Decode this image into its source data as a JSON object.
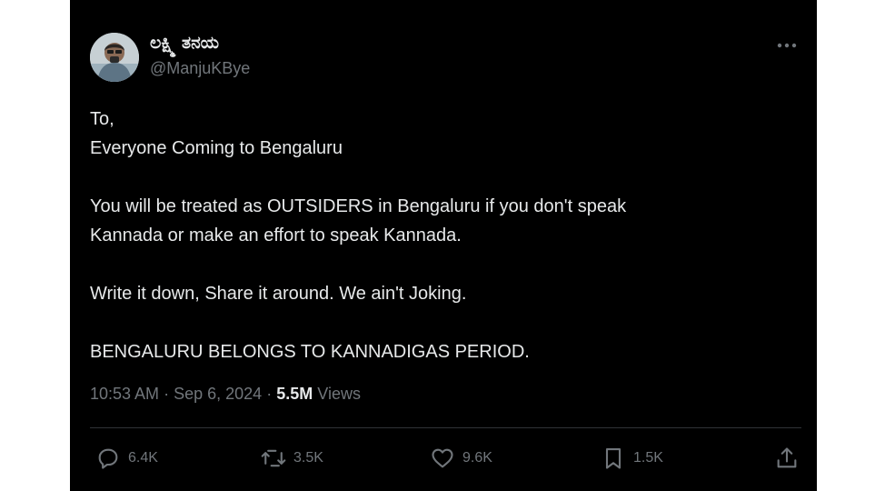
{
  "author": {
    "display_name": "ಲಕ್ಷ್ಮಿ ತನಯ",
    "handle": "@ManjuKBye",
    "avatar_icon": "user-photo-avatar"
  },
  "tweet": {
    "lines": [
      "To,",
      "Everyone Coming to Bengaluru",
      "",
      "You will be treated as OUTSIDERS in Bengaluru if you don't speak",
      "Kannada or make an effort to speak Kannada.",
      "",
      "Write it down, Share it around. We ain't Joking.",
      "",
      "BENGALURU BELONGS TO KANNADIGAS PERIOD."
    ],
    "time": "10:53 AM",
    "date": "Sep 6, 2024",
    "separator": "·",
    "views_count": "5.5M",
    "views_label": "Views"
  },
  "actions": {
    "replies": "6.4K",
    "reposts": "3.5K",
    "likes": "9.6K",
    "bookmarks": "1.5K"
  },
  "colors": {
    "background": "#000000",
    "text": "#e7e9ea",
    "muted": "#71767b",
    "divider": "#2f3336"
  }
}
